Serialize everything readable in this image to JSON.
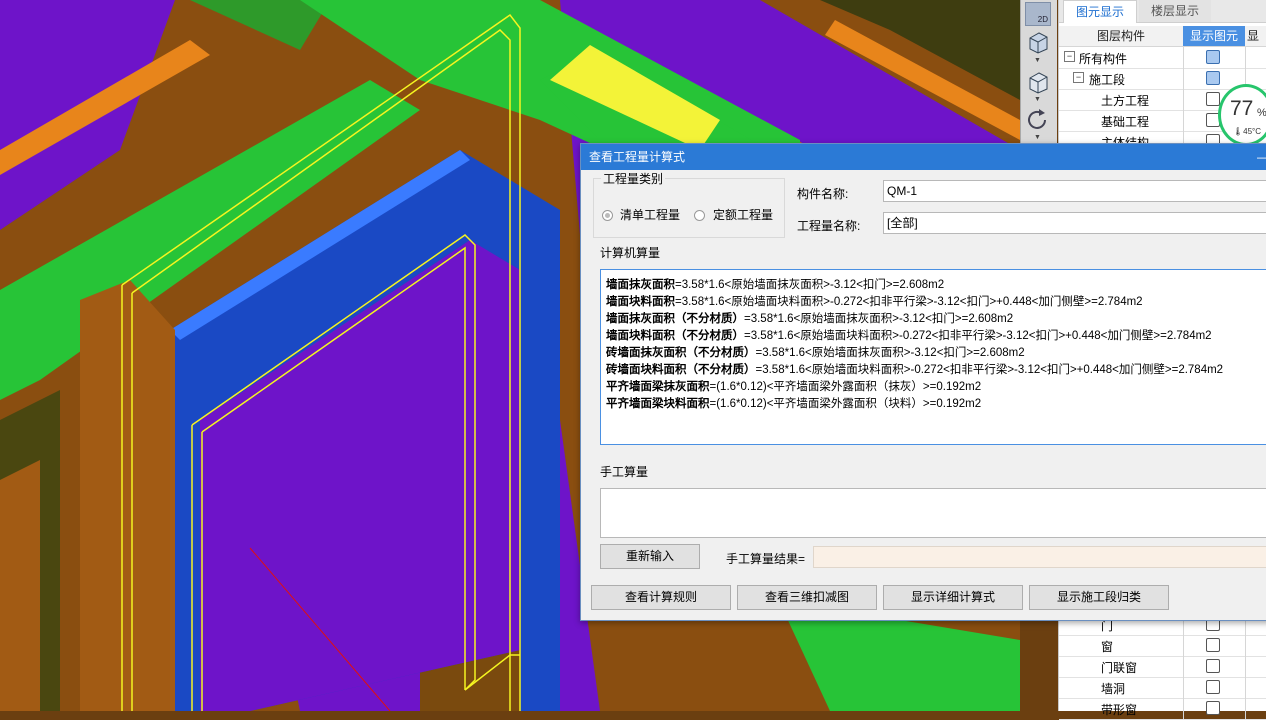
{
  "viewport3d": {
    "colors": {
      "brown": "#9a5712",
      "green": "#27c437",
      "blue": "#1a49c4",
      "purple": "#6e14c9",
      "yellow": "#f3f338",
      "orange": "#e8851b",
      "dark": "#3e3d10"
    }
  },
  "view_toolbar": {
    "items": [
      {
        "name": "2d",
        "label": "2D"
      },
      {
        "name": "cube-view",
        "label": ""
      },
      {
        "name": "cube-view-2",
        "label": ""
      },
      {
        "name": "rotate",
        "label": ""
      }
    ]
  },
  "right_panel": {
    "tabs": [
      {
        "label": "图元显示",
        "active": true
      },
      {
        "label": "楼层显示",
        "active": false
      }
    ],
    "columns": {
      "name": "图层构件",
      "show": "显示图元",
      "extra": "显"
    },
    "rows_top": [
      {
        "label": "所有构件",
        "level": 0,
        "expander": "−",
        "checked": true
      },
      {
        "label": "施工段",
        "level": 1,
        "expander": "−",
        "checked": true
      },
      {
        "label": "土方工程",
        "level": 2,
        "checked": false
      },
      {
        "label": "基础工程",
        "level": 2,
        "checked": false
      },
      {
        "label": "主体结构",
        "level": 2,
        "checked": false
      }
    ],
    "rows_bottom": [
      {
        "label": "门",
        "level": 2,
        "checked": false
      },
      {
        "label": "窗",
        "level": 2,
        "checked": false
      },
      {
        "label": "门联窗",
        "level": 2,
        "checked": false
      },
      {
        "label": "墙洞",
        "level": 2,
        "checked": false
      },
      {
        "label": "带形窗",
        "level": 2,
        "checked": false
      }
    ]
  },
  "gauge": {
    "percent": "77",
    "unit": "%",
    "temp": "45°C"
  },
  "dialog": {
    "title": "查看工程量计算式",
    "minimize": "—",
    "type_group": {
      "title": "工程量类别",
      "options": [
        {
          "label": "清单工程量",
          "selected": true
        },
        {
          "label": "定额工程量",
          "selected": false
        }
      ]
    },
    "component_name_label": "构件名称:",
    "component_name_value": "QM-1",
    "quantity_name_label": "工程量名称:",
    "quantity_name_value": "[全部]",
    "computer_section": "计算机算量",
    "calc_lines": [
      {
        "name": "墙面抹灰面积",
        "formula": "=3.58*1.6<原始墙面抹灰面积>-3.12<扣门>=2.608m2"
      },
      {
        "name": "墙面块料面积",
        "formula": "=3.58*1.6<原始墙面块料面积>-0.272<扣非平行梁>-3.12<扣门>+0.448<加门侧壁>=2.784m2"
      },
      {
        "name": "墙面抹灰面积（不分材质）",
        "formula": "=3.58*1.6<原始墙面抹灰面积>-3.12<扣门>=2.608m2"
      },
      {
        "name": "墙面块料面积（不分材质）",
        "formula": "=3.58*1.6<原始墙面块料面积>-0.272<扣非平行梁>-3.12<扣门>+0.448<加门侧壁>=2.784m2"
      },
      {
        "name": "砖墙面抹灰面积（不分材质）",
        "formula": "=3.58*1.6<原始墙面抹灰面积>-3.12<扣门>=2.608m2"
      },
      {
        "name": "砖墙面块料面积（不分材质）",
        "formula": "=3.58*1.6<原始墙面块料面积>-0.272<扣非平行梁>-3.12<扣门>+0.448<加门侧壁>=2.784m2"
      },
      {
        "name": "平齐墙面梁抹灰面积",
        "formula": "=(1.6*0.12)<平齐墙面梁外露面积（抹灰）>=0.192m2"
      },
      {
        "name": "平齐墙面梁块料面积",
        "formula": "=(1.6*0.12)<平齐墙面梁外露面积（块料）>=0.192m2"
      }
    ],
    "manual_section": "手工算量",
    "reenter_button": "重新输入",
    "manual_result_label": "手工算量结果=",
    "buttons": [
      "查看计算规则",
      "查看三维扣减图",
      "显示详细计算式",
      "显示施工段归类"
    ]
  }
}
